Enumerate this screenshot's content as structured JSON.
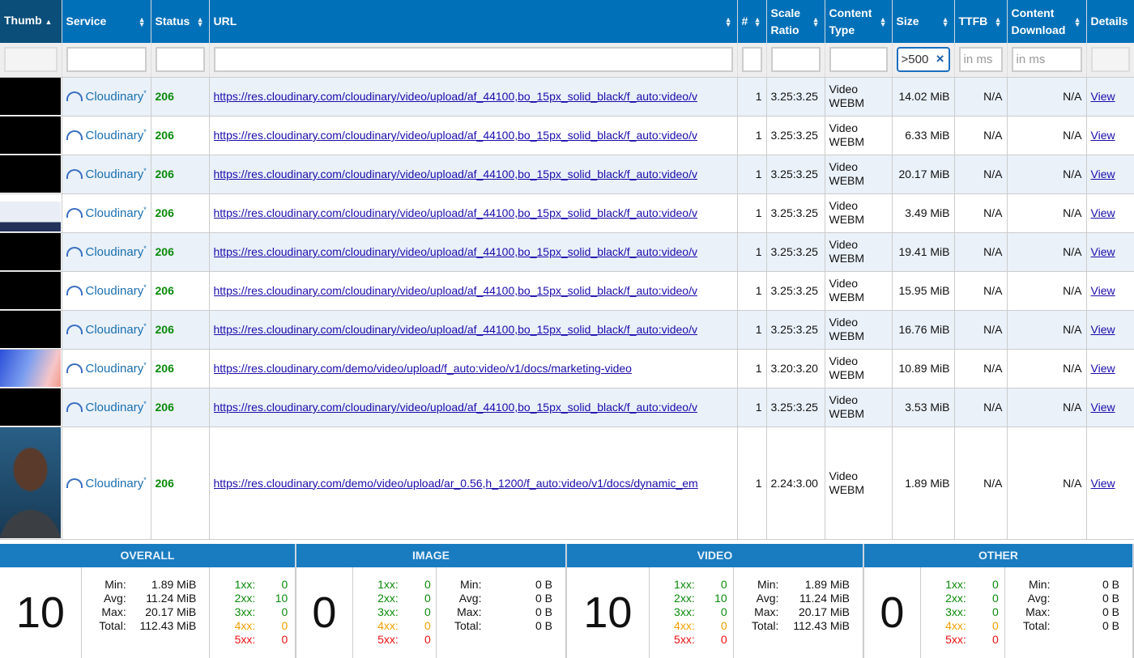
{
  "columns": [
    "Thumb",
    "Service",
    "Status",
    "URL",
    "#",
    "Scale Ratio",
    "Content Type",
    "Size",
    "TTFB",
    "Content Download",
    "Details"
  ],
  "filters": {
    "size_value": ">500",
    "ttfb_placeholder": "in ms",
    "download_placeholder": "in ms",
    "clear_icon": "×"
  },
  "rows": [
    {
      "thumb": "black",
      "service": "Cloudinary",
      "status": "206",
      "url": "https://res.cloudinary.com/cloudinary/video/upload/af_44100,bo_15px_solid_black/f_auto:video/v",
      "count": "1",
      "scale": "3.25:3.25",
      "type1": "Video",
      "type2": "WEBM",
      "size": "14.02 MiB",
      "ttfb": "N/A",
      "download": "N/A",
      "details": "View"
    },
    {
      "thumb": "black",
      "service": "Cloudinary",
      "status": "206",
      "url": "https://res.cloudinary.com/cloudinary/video/upload/af_44100,bo_15px_solid_black/f_auto:video/v",
      "count": "1",
      "scale": "3.25:3.25",
      "type1": "Video",
      "type2": "WEBM",
      "size": "6.33 MiB",
      "ttfb": "N/A",
      "download": "N/A",
      "details": "View"
    },
    {
      "thumb": "black",
      "service": "Cloudinary",
      "status": "206",
      "url": "https://res.cloudinary.com/cloudinary/video/upload/af_44100,bo_15px_solid_black/f_auto:video/v",
      "count": "1",
      "scale": "3.25:3.25",
      "type1": "Video",
      "type2": "WEBM",
      "size": "20.17 MiB",
      "ttfb": "N/A",
      "download": "N/A",
      "details": "View"
    },
    {
      "thumb": "shot",
      "service": "Cloudinary",
      "status": "206",
      "url": "https://res.cloudinary.com/cloudinary/video/upload/af_44100,bo_15px_solid_black/f_auto:video/v",
      "count": "1",
      "scale": "3.25:3.25",
      "type1": "Video",
      "type2": "WEBM",
      "size": "3.49 MiB",
      "ttfb": "N/A",
      "download": "N/A",
      "details": "View"
    },
    {
      "thumb": "black",
      "service": "Cloudinary",
      "status": "206",
      "url": "https://res.cloudinary.com/cloudinary/video/upload/af_44100,bo_15px_solid_black/f_auto:video/v",
      "count": "1",
      "scale": "3.25:3.25",
      "type1": "Video",
      "type2": "WEBM",
      "size": "19.41 MiB",
      "ttfb": "N/A",
      "download": "N/A",
      "details": "View"
    },
    {
      "thumb": "black",
      "service": "Cloudinary",
      "status": "206",
      "url": "https://res.cloudinary.com/cloudinary/video/upload/af_44100,bo_15px_solid_black/f_auto:video/v",
      "count": "1",
      "scale": "3.25:3.25",
      "type1": "Video",
      "type2": "WEBM",
      "size": "15.95 MiB",
      "ttfb": "N/A",
      "download": "N/A",
      "details": "View"
    },
    {
      "thumb": "black",
      "service": "Cloudinary",
      "status": "206",
      "url": "https://res.cloudinary.com/cloudinary/video/upload/af_44100,bo_15px_solid_black/f_auto:video/v",
      "count": "1",
      "scale": "3.25:3.25",
      "type1": "Video",
      "type2": "WEBM",
      "size": "16.76 MiB",
      "ttfb": "N/A",
      "download": "N/A",
      "details": "View"
    },
    {
      "thumb": "grad",
      "service": "Cloudinary",
      "status": "206",
      "url": "https://res.cloudinary.com/demo/video/upload/f_auto:video/v1/docs/marketing-video",
      "count": "1",
      "scale": "3.20:3.20",
      "type1": "Video",
      "type2": "WEBM",
      "size": "10.89 MiB",
      "ttfb": "N/A",
      "download": "N/A",
      "details": "View"
    },
    {
      "thumb": "black",
      "service": "Cloudinary",
      "status": "206",
      "url": "https://res.cloudinary.com/cloudinary/video/upload/af_44100,bo_15px_solid_black/f_auto:video/v",
      "count": "1",
      "scale": "3.25:3.25",
      "type1": "Video",
      "type2": "WEBM",
      "size": "3.53 MiB",
      "ttfb": "N/A",
      "download": "N/A",
      "details": "View"
    },
    {
      "thumb": "person",
      "service": "Cloudinary",
      "status": "206",
      "url": "https://res.cloudinary.com/demo/video/upload/ar_0.56,h_1200/f_auto:video/v1/docs/dynamic_em",
      "count": "1",
      "scale": "2.24:3.00",
      "type1": "Video",
      "type2": "WEBM",
      "size": "1.89 MiB",
      "ttfb": "N/A",
      "download": "N/A",
      "details": "View"
    }
  ],
  "summary": [
    {
      "title": "OVERALL",
      "count": "10",
      "order": "stats-first",
      "stats": [
        [
          "Min:",
          "1.89 MiB"
        ],
        [
          "Avg:",
          "11.24 MiB"
        ],
        [
          "Max:",
          "20.17 MiB"
        ],
        [
          "Total:",
          "112.43 MiB"
        ]
      ],
      "codes": [
        [
          "1xx:",
          "0"
        ],
        [
          "2xx:",
          "10"
        ],
        [
          "3xx:",
          "0"
        ],
        [
          "4xx:",
          "0"
        ],
        [
          "5xx:",
          "0"
        ]
      ]
    },
    {
      "title": "IMAGE",
      "count": "0",
      "order": "codes-first",
      "stats": [
        [
          "Min:",
          "0 B"
        ],
        [
          "Avg:",
          "0 B"
        ],
        [
          "Max:",
          "0 B"
        ],
        [
          "Total:",
          "0 B"
        ]
      ],
      "codes": [
        [
          "1xx:",
          "0"
        ],
        [
          "2xx:",
          "0"
        ],
        [
          "3xx:",
          "0"
        ],
        [
          "4xx:",
          "0"
        ],
        [
          "5xx:",
          "0"
        ]
      ]
    },
    {
      "title": "VIDEO",
      "count": "10",
      "order": "codes-first",
      "stats": [
        [
          "Min:",
          "1.89 MiB"
        ],
        [
          "Avg:",
          "11.24 MiB"
        ],
        [
          "Max:",
          "20.17 MiB"
        ],
        [
          "Total:",
          "112.43 MiB"
        ]
      ],
      "codes": [
        [
          "1xx:",
          "0"
        ],
        [
          "2xx:",
          "10"
        ],
        [
          "3xx:",
          "0"
        ],
        [
          "4xx:",
          "0"
        ],
        [
          "5xx:",
          "0"
        ]
      ]
    },
    {
      "title": "OTHER",
      "count": "0",
      "order": "codes-first",
      "stats": [
        [
          "Min:",
          "0 B"
        ],
        [
          "Avg:",
          "0 B"
        ],
        [
          "Max:",
          "0 B"
        ],
        [
          "Total:",
          "0 B"
        ]
      ],
      "codes": [
        [
          "1xx:",
          "0"
        ],
        [
          "2xx:",
          "0"
        ],
        [
          "3xx:",
          "0"
        ],
        [
          "4xx:",
          "0"
        ],
        [
          "5xx:",
          "0"
        ]
      ]
    }
  ]
}
